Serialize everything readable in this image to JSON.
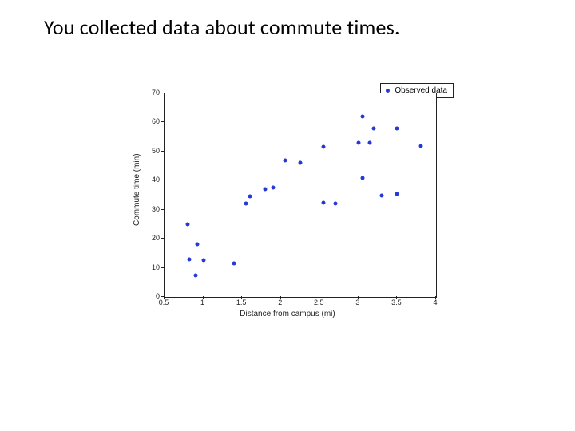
{
  "title": "You collected data about commute times.",
  "legend_label": "Observed data",
  "xlabel": "Distance from campus (mi)",
  "ylabel": "Commute time (min)",
  "chart_data": {
    "type": "scatter",
    "title": "",
    "xlabel": "Distance from campus (mi)",
    "ylabel": "Commute time (min)",
    "xlim": [
      0.5,
      4.0
    ],
    "ylim": [
      0,
      70
    ],
    "xticks": [
      0.5,
      1,
      1.5,
      2,
      2.5,
      3,
      3.5,
      4
    ],
    "yticks": [
      0,
      10,
      20,
      30,
      40,
      50,
      60,
      70
    ],
    "legend": [
      "Observed data"
    ],
    "legend_position": "top-right",
    "grid": false,
    "series": [
      {
        "name": "Observed data",
        "x": [
          0.8,
          0.82,
          0.9,
          0.92,
          1.0,
          1.4,
          1.55,
          1.6,
          1.8,
          1.9,
          2.05,
          2.25,
          2.55,
          2.55,
          2.7,
          3.0,
          3.05,
          3.05,
          3.15,
          3.2,
          3.3,
          3.5,
          3.5,
          3.8
        ],
        "y": [
          25.0,
          13.0,
          7.5,
          18.0,
          12.5,
          11.5,
          32.0,
          34.5,
          37.0,
          37.5,
          47.0,
          46.0,
          32.5,
          51.5,
          32.0,
          53.0,
          41.0,
          62.0,
          53.0,
          58.0,
          35.0,
          35.5,
          58.0,
          52.0
        ]
      }
    ]
  }
}
